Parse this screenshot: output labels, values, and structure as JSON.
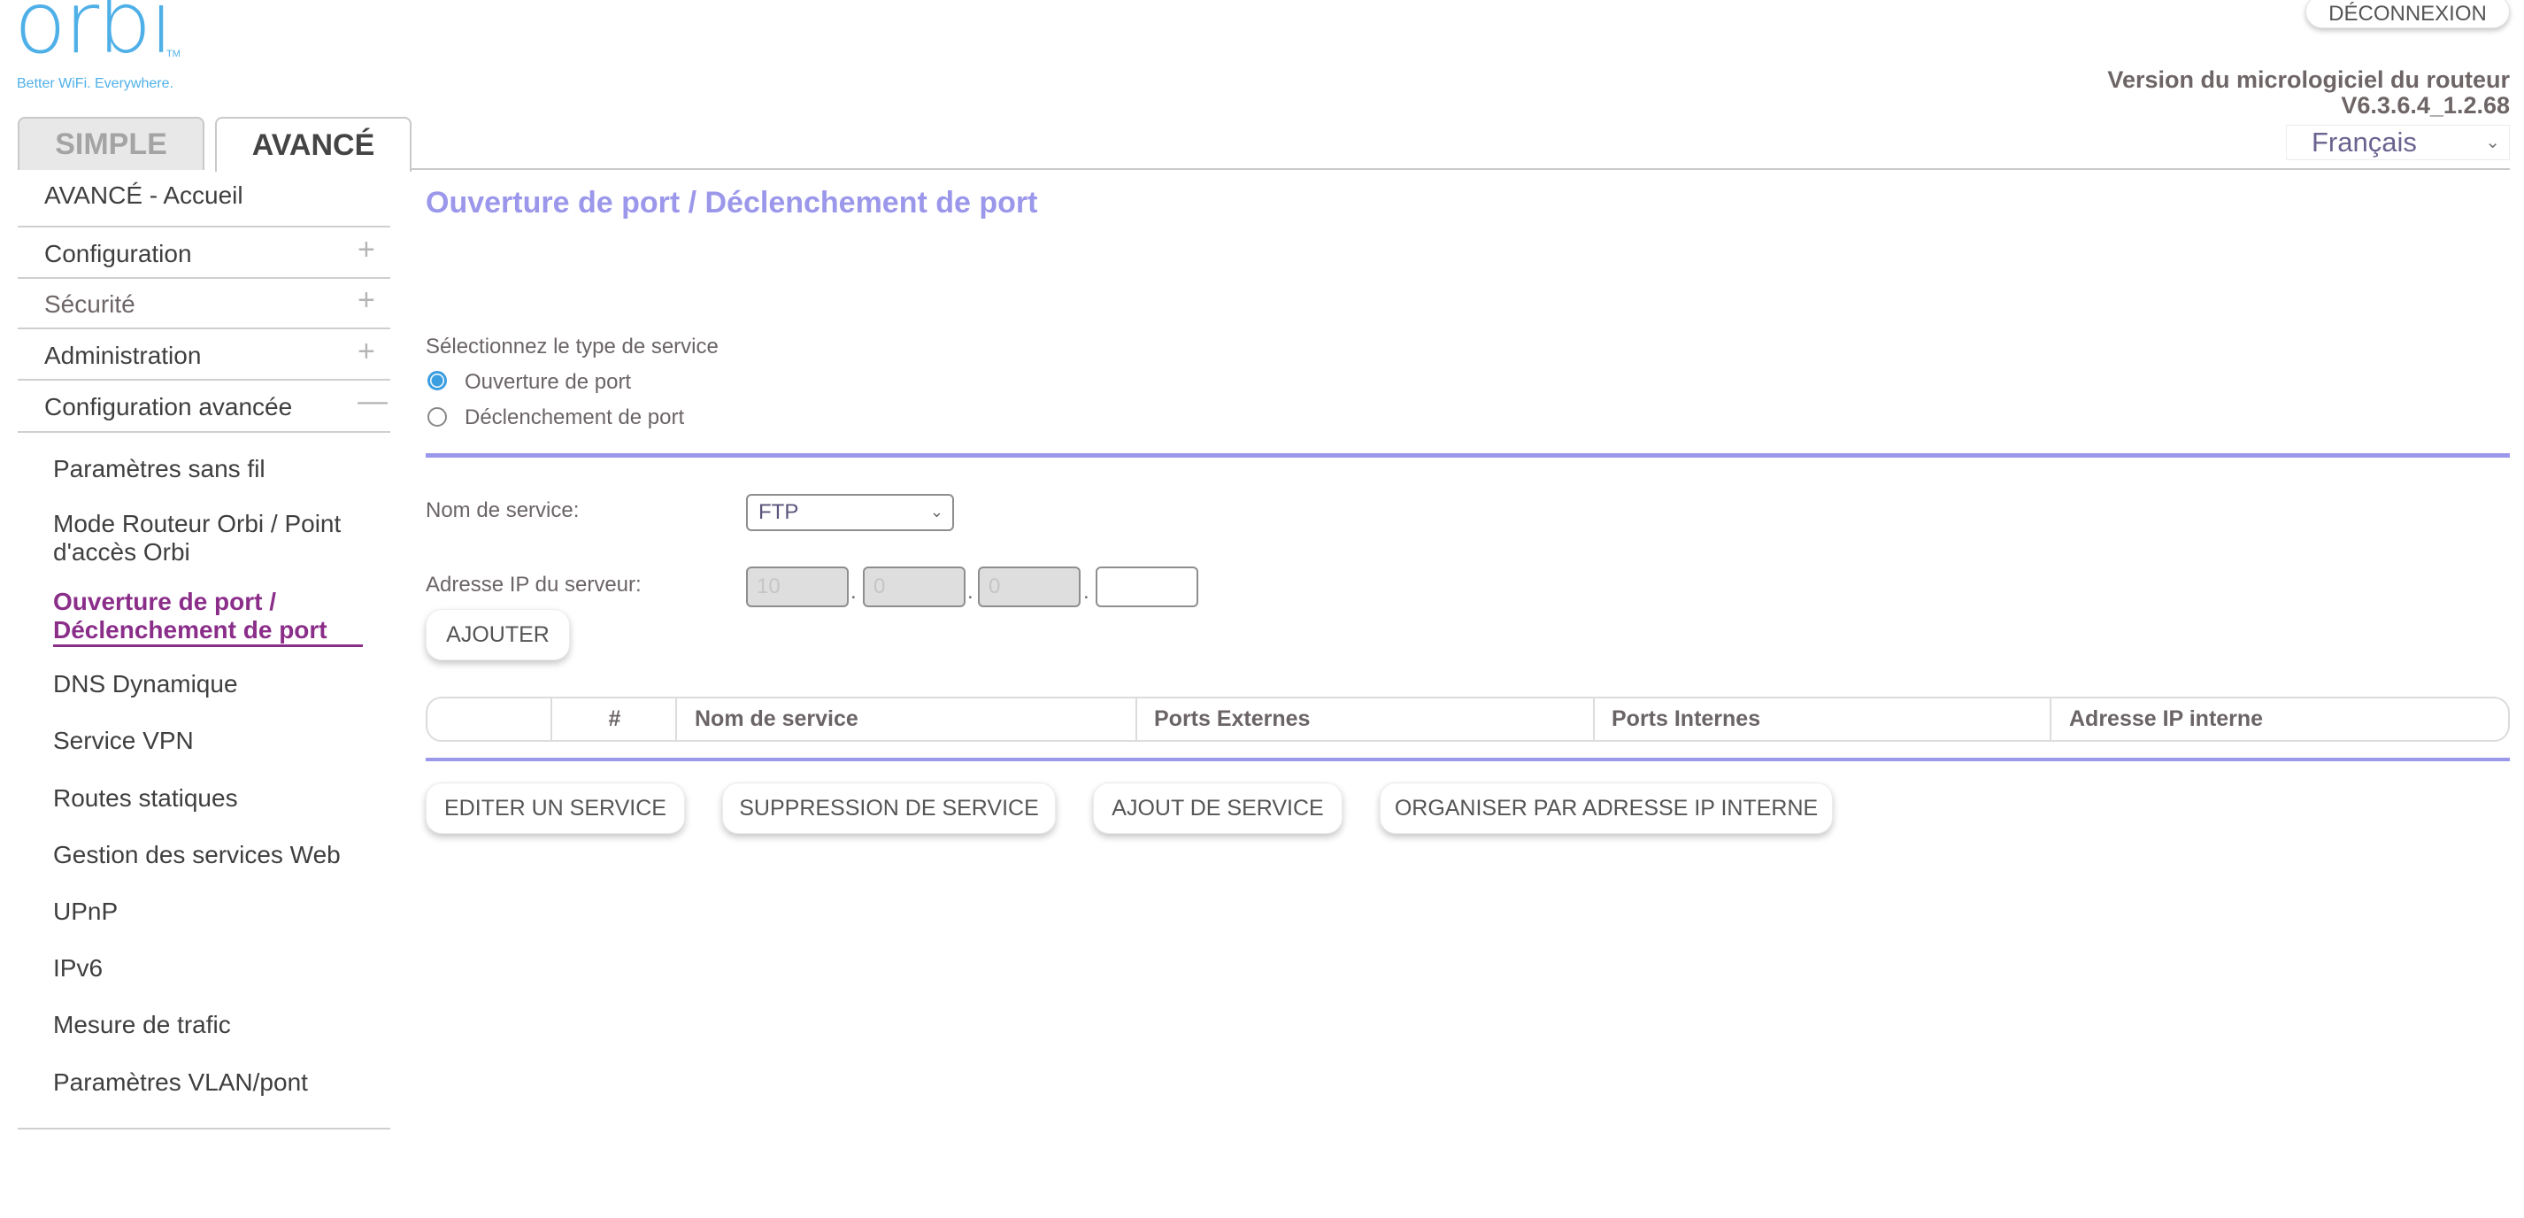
{
  "brand": {
    "logo_text": "orbi",
    "trademark": "TM",
    "tagline": "Better WiFi. Everywhere.",
    "color": "#4fb0e8"
  },
  "tabs": [
    {
      "label": "SIMPLE",
      "active": false
    },
    {
      "label": "AVANCÉ",
      "active": true
    }
  ],
  "header": {
    "logout_label": "DÉCONNEXION",
    "firmware_label": "Version du micrologiciel du routeur",
    "firmware_version": "V6.3.6.4_1.2.68",
    "language": "Français"
  },
  "sidebar": {
    "items": [
      {
        "label": "AVANCÉ - Accueil",
        "expandable": false
      },
      {
        "label": "Configuration",
        "expandable": true,
        "icon": "plus-icon"
      },
      {
        "label": "Sécurité",
        "expandable": true,
        "icon": "plus-icon"
      },
      {
        "label": "Administration",
        "expandable": true,
        "icon": "plus-icon"
      },
      {
        "label": "Configuration avancée",
        "expandable": true,
        "expanded": true,
        "icon": "minus-icon"
      }
    ],
    "subitems": [
      {
        "label": "Paramètres sans fil"
      },
      {
        "label_line1": "Mode Routeur Orbi / Point",
        "label_line2": "d'accès Orbi"
      },
      {
        "label_line1": "Ouverture de port /",
        "label_line2": "Déclenchement de port",
        "active": true
      },
      {
        "label": "DNS Dynamique"
      },
      {
        "label": "Service VPN"
      },
      {
        "label": "Routes statiques"
      },
      {
        "label": "Gestion des services Web"
      },
      {
        "label": "UPnP"
      },
      {
        "label": "IPv6"
      },
      {
        "label": "Mesure de trafic"
      },
      {
        "label": "Paramètres VLAN/pont"
      }
    ],
    "active_color": "#8b2e8a"
  },
  "main": {
    "title": "Ouverture de port / Déclenchement de port",
    "title_color": "#9b97ea",
    "service_type": {
      "label": "Sélectionnez le type de service",
      "options": [
        {
          "label": "Ouverture de port",
          "checked": true
        },
        {
          "label": "Déclenchement de port",
          "checked": false
        }
      ]
    },
    "service_name": {
      "label": "Nom de service:",
      "value": "FTP"
    },
    "server_ip": {
      "label": "Adresse IP du serveur:",
      "octets": [
        "10",
        "0",
        "0",
        ""
      ],
      "separator": "."
    },
    "add_button": "AJOUTER",
    "table": {
      "columns": [
        "",
        "#",
        "Nom de service",
        "Ports Externes",
        "Ports Internes",
        "Adresse IP interne"
      ],
      "rows": []
    },
    "actions": [
      "EDITER UN SERVICE",
      "SUPPRESSION DE SERVICE",
      "AJOUT DE SERVICE",
      "ORGANISER PAR ADRESSE IP INTERNE"
    ]
  }
}
